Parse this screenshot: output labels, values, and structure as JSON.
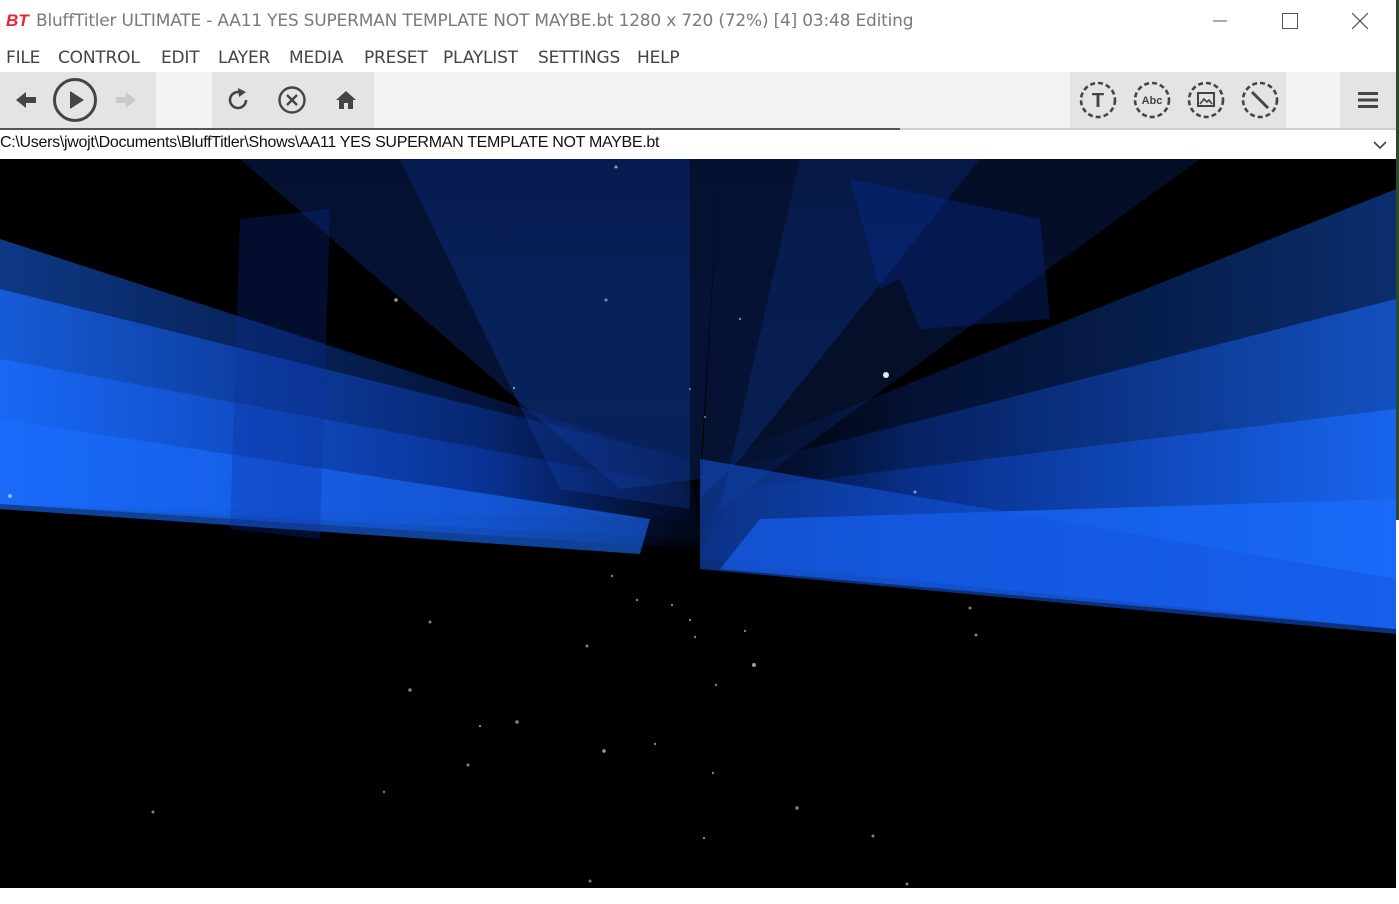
{
  "window": {
    "title": "BluffTitler ULTIMATE  - AA11 YES SUPERMAN TEMPLATE NOT MAYBE.bt 1280 x 720 (72%) [4] 03:48 Editing",
    "logo_text": "BT",
    "controls": [
      "minimize",
      "maximize",
      "close"
    ]
  },
  "menu": {
    "items": [
      {
        "label": "FILE"
      },
      {
        "label": "CONTROL"
      },
      {
        "label": "EDIT"
      },
      {
        "label": "LAYER"
      },
      {
        "label": "MEDIA"
      },
      {
        "label": "PRESET"
      },
      {
        "label": "PLAYLIST"
      },
      {
        "label": "SETTINGS"
      },
      {
        "label": "HELP"
      }
    ]
  },
  "toolbar": {
    "playback": [
      {
        "icon": "arrow-left-icon",
        "name": "previous"
      },
      {
        "icon": "play-icon",
        "name": "play"
      },
      {
        "icon": "arrow-right-icon",
        "name": "next",
        "disabled": true
      }
    ],
    "actions": [
      {
        "icon": "refresh-icon",
        "name": "refresh"
      },
      {
        "icon": "cancel-icon",
        "name": "cancel"
      },
      {
        "icon": "home-icon",
        "name": "home"
      }
    ],
    "layers": [
      {
        "icon": "text-layer-icon",
        "glyph": "T"
      },
      {
        "icon": "abc-layer-icon",
        "glyph": "Abc"
      },
      {
        "icon": "picture-layer-icon",
        "glyph": ""
      },
      {
        "icon": "line-layer-icon",
        "glyph": ""
      }
    ],
    "menu_icon": "hamburger-menu-icon"
  },
  "pathbar": {
    "path": "C:\\Users\\jwojt\\Documents\\BluffTitler\\Shows\\AA11 YES SUPERMAN TEMPLATE NOT MAYBE.bt"
  },
  "viewport": {
    "background": "#000000",
    "beam_color": "#1a6cff"
  },
  "colors": {
    "logo_red": "#e8242c",
    "toolbar_bg": "#f3f3f3",
    "toolbar_group_bg": "#e4e4e4",
    "icon_dark": "#444444"
  }
}
